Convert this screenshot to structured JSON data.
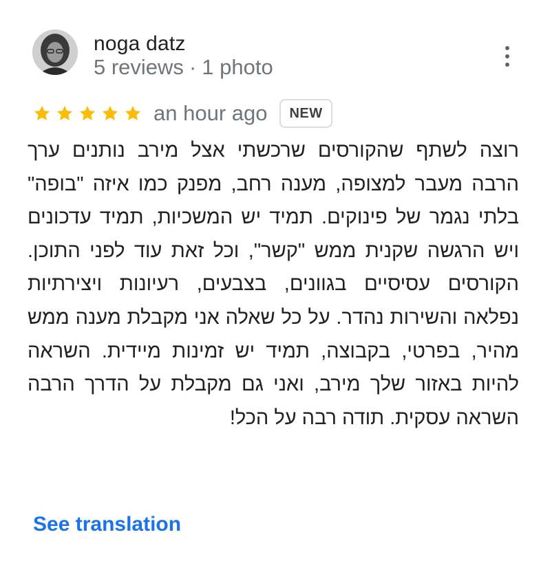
{
  "review": {
    "author": {
      "name": "noga datz",
      "reviews_count": "5 reviews",
      "separator": "·",
      "photos_count": "1 photo"
    },
    "rating": 5,
    "star_color": "#fbbc04",
    "time_ago": "an hour ago",
    "badge": "NEW",
    "text": "רוצה לשתף שהקורסים שרכשתי אצל מירב נותנים ערך הרבה מעבר למצופה, מענה רחב, מפנק כמו איזה \"בופה\" בלתי נגמר של פינוקים. תמיד יש המשכיות, תמיד עדכונים ויש הרגשה שקנית ממש \"קשר\", וכל זאת עוד לפני התוכן. הקורסים עסיסיים בגוונים, בצבעים, רעיונות ויצירתיות נפלאה והשירות נהדר. על כל שאלה אני מקבלת מענה ממש מהיר, בפרטי, בקבוצה, תמיד יש זמינות מיידית. השראה להיות באזור שלך מירב, ואני גם מקבלת על הדרך הרבה השראה עסקית. תודה רבה על הכל!",
    "see_translation": "See translation",
    "link_color": "#1a73e8"
  },
  "icons": {
    "avatar": "user-avatar-photo",
    "more": "more-vert-icon",
    "star": "star-icon"
  }
}
